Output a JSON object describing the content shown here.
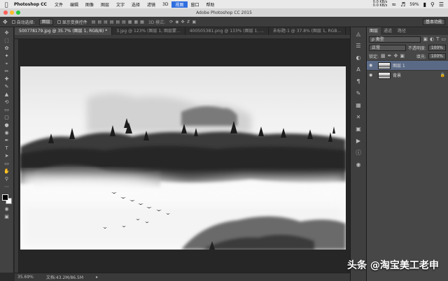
{
  "menubar": {
    "app_name": "Photoshop CC",
    "items": [
      "文件",
      "编辑",
      "图像",
      "图层",
      "文字",
      "选择",
      "滤镜",
      "3D",
      "视图",
      "窗口",
      "帮助"
    ],
    "active_index": 8,
    "net_up": "0.0 KB/s",
    "net_down": "0.0 KB/s",
    "battery": "59%"
  },
  "window": {
    "title": "Adobe Photoshop CC 2015"
  },
  "options_bar": {
    "auto_select_label": "自动选择:",
    "auto_select_value": "图层",
    "show_transform_label": "显示变换控件",
    "mode_3d_label": "3D 模式:",
    "workspace": "基本功能"
  },
  "tabs": [
    {
      "label": "500778179.jpg @ 35.7% (图层 1, RGB/8) *",
      "active": true
    },
    {
      "label": "3.jpg @ 123% (图层 1, 图层蒙...",
      "active": false
    },
    {
      "label": "400505381.png @ 133% (图层 1, ...",
      "active": false
    },
    {
      "label": "未标题-1 @ 37.8% (图层 1, RGB...",
      "active": false
    }
  ],
  "status_bar": {
    "zoom": "35.69%",
    "doc_size": "文档:43.2M/86.5M"
  },
  "layers_panel": {
    "tabs": [
      "图层",
      "通道",
      "路径"
    ],
    "filter_value": "ρ 类型",
    "blend_mode": "正常",
    "opacity_label": "不透明度:",
    "opacity_value": "100%",
    "lock_label": "锁定:",
    "fill_label": "填充:",
    "fill_value": "100%",
    "layers": [
      {
        "name": "图层 1",
        "selected": true,
        "locked": false
      },
      {
        "name": "背景",
        "selected": false,
        "locked": true
      }
    ]
  },
  "watermark": "头条 @淘宝美工老申",
  "colors": {
    "menubar_active": "#2f6fe0",
    "layer_selected": "#5a6a86",
    "panel_bg": "#474747",
    "canvas_bg": "#262626"
  }
}
